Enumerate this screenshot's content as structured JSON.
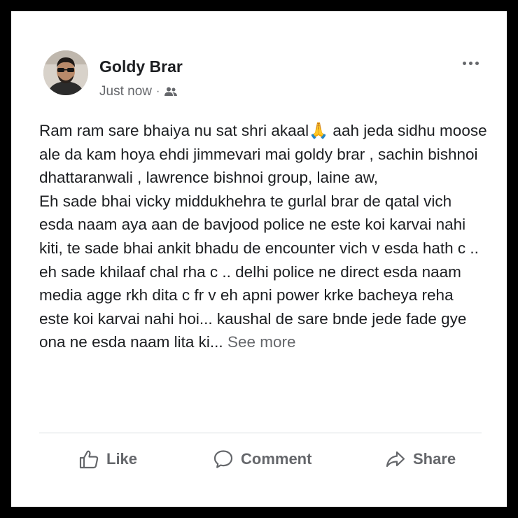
{
  "post": {
    "author": "Goldy Brar",
    "timestamp": "Just now",
    "separator": "·",
    "audience_icon": "friends-icon",
    "menu_icon": "more-options-icon",
    "text": "Ram ram sare bhaiya nu sat shri akaal🙏 aah jeda sidhu moose ale da kam hoya ehdi jimmevari mai goldy brar , sachin bishnoi dhattaranwali , lawrence bishnoi group,  laine aw,\nEh sade bhai vicky middukhehra te gurlal brar de qatal vich esda naam aya aan de bavjood police ne este koi karvai nahi kiti, te sade bhai ankit bhadu de encounter vich v esda hath c .. eh sade khilaaf chal rha c .. delhi police ne direct esda naam media agge rkh dita c fr v eh apni power krke bacheya reha este koi karvai nahi hoi... kaushal de sare bnde jede fade gye ona ne esda naam lita ki...",
    "see_more": "See more"
  },
  "actions": {
    "like": {
      "label": "Like",
      "icon": "thumbs-up-icon"
    },
    "comment": {
      "label": "Comment",
      "icon": "comment-icon"
    },
    "share": {
      "label": "Share",
      "icon": "share-icon"
    }
  },
  "colors": {
    "frame": "#000000",
    "background": "#ffffff",
    "text": "#1c1e21",
    "secondary": "#65676b",
    "divider": "#dadde1"
  }
}
